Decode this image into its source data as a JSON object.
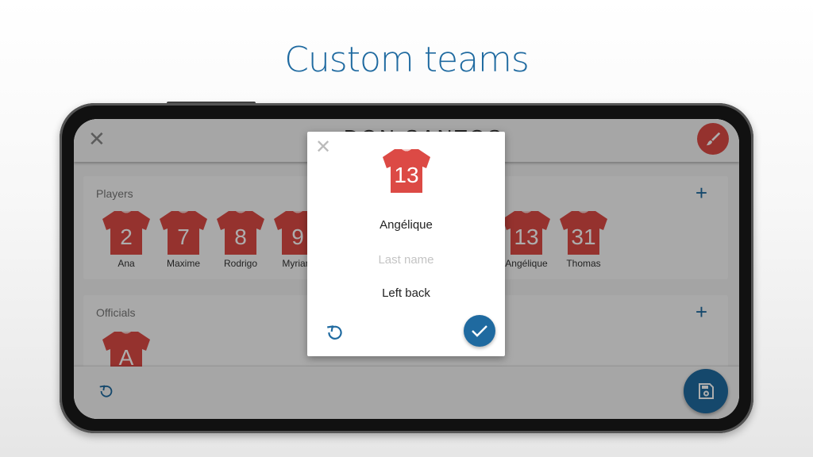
{
  "headline": "Custom teams",
  "colors": {
    "accent": "#1f6aa0",
    "shirt": "#dc4a45"
  },
  "app": {
    "team_name": "DON SANTOS",
    "close_icon": "close-icon",
    "edit_icon": "brush-icon",
    "players": {
      "label": "Players",
      "add_icon": "plus-icon",
      "items": [
        {
          "number": "2",
          "name": "Ana"
        },
        {
          "number": "7",
          "name": "Maxime"
        },
        {
          "number": "8",
          "name": "Rodrigo"
        },
        {
          "number": "9",
          "name": "Myriam"
        },
        {
          "number": "13",
          "name": "Angélique"
        },
        {
          "number": "31",
          "name": "Thomas"
        }
      ]
    },
    "officials": {
      "label": "Officials",
      "add_icon": "plus-icon",
      "items": [
        {
          "number": "A"
        }
      ]
    },
    "undo_icon": "undo-icon",
    "save_icon": "save-icon"
  },
  "dialog": {
    "number": "13",
    "first_name": "Angélique",
    "last_name_placeholder": "Last name",
    "position": "Left back",
    "close_icon": "close-icon",
    "reset_icon": "undo-icon",
    "confirm_icon": "check-icon"
  }
}
